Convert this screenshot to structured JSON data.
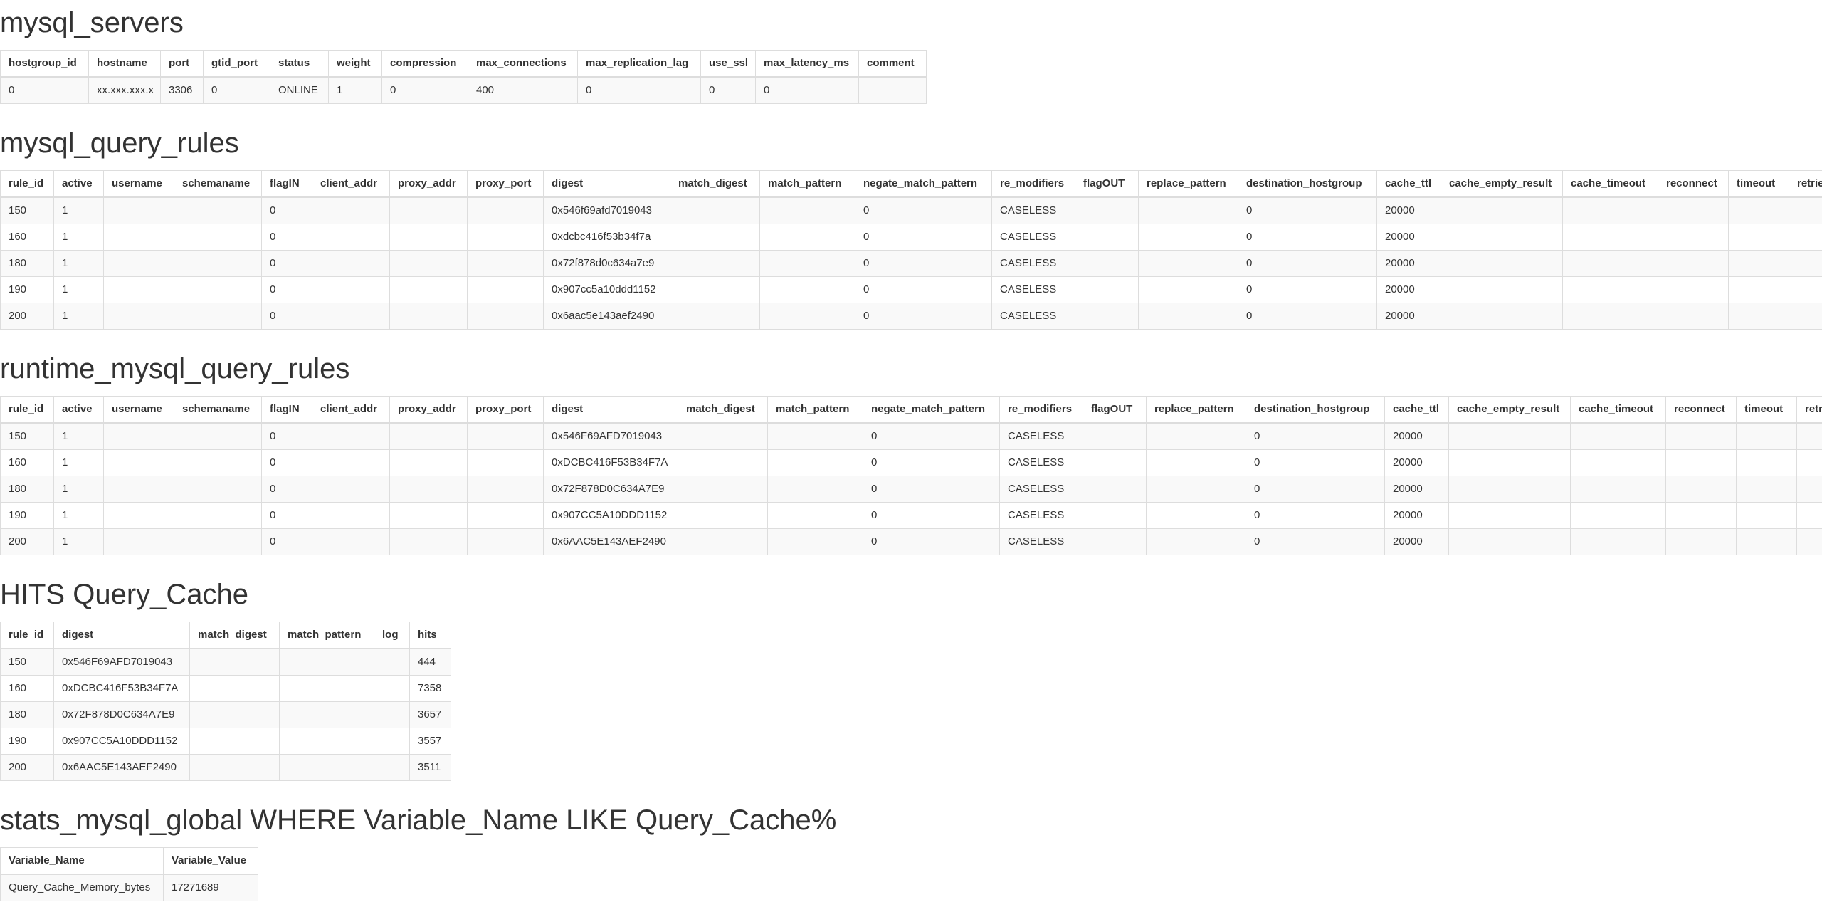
{
  "sections": [
    {
      "title": "mysql_servers",
      "headers": [
        "hostgroup_id",
        "hostname",
        "port",
        "gtid_port",
        "status",
        "weight",
        "compression",
        "max_connections",
        "max_replication_lag",
        "use_ssl",
        "max_latency_ms",
        "comment"
      ],
      "rows": [
        [
          "0",
          "xx.xxx.xxx.x",
          "3306",
          "0",
          "ONLINE",
          "1",
          "0",
          "400",
          "0",
          "0",
          "0",
          ""
        ]
      ]
    },
    {
      "title": "mysql_query_rules",
      "headers": [
        "rule_id",
        "active",
        "username",
        "schemaname",
        "flagIN",
        "client_addr",
        "proxy_addr",
        "proxy_port",
        "digest",
        "match_digest",
        "match_pattern",
        "negate_match_pattern",
        "re_modifiers",
        "flagOUT",
        "replace_pattern",
        "destination_hostgroup",
        "cache_ttl",
        "cache_empty_result",
        "cache_timeout",
        "reconnect",
        "timeout",
        "retries"
      ],
      "rows": [
        [
          "150",
          "1",
          "",
          "",
          "0",
          "",
          "",
          "",
          "0x546f69afd7019043",
          "",
          "",
          "0",
          "CASELESS",
          "",
          "",
          "0",
          "20000",
          "",
          "",
          "",
          "",
          ""
        ],
        [
          "160",
          "1",
          "",
          "",
          "0",
          "",
          "",
          "",
          "0xdcbc416f53b34f7a",
          "",
          "",
          "0",
          "CASELESS",
          "",
          "",
          "0",
          "20000",
          "",
          "",
          "",
          "",
          ""
        ],
        [
          "180",
          "1",
          "",
          "",
          "0",
          "",
          "",
          "",
          "0x72f878d0c634a7e9",
          "",
          "",
          "0",
          "CASELESS",
          "",
          "",
          "0",
          "20000",
          "",
          "",
          "",
          "",
          ""
        ],
        [
          "190",
          "1",
          "",
          "",
          "0",
          "",
          "",
          "",
          "0x907cc5a10ddd1152",
          "",
          "",
          "0",
          "CASELESS",
          "",
          "",
          "0",
          "20000",
          "",
          "",
          "",
          "",
          ""
        ],
        [
          "200",
          "1",
          "",
          "",
          "0",
          "",
          "",
          "",
          "0x6aac5e143aef2490",
          "",
          "",
          "0",
          "CASELESS",
          "",
          "",
          "0",
          "20000",
          "",
          "",
          "",
          "",
          ""
        ]
      ]
    },
    {
      "title": "runtime_mysql_query_rules",
      "headers": [
        "rule_id",
        "active",
        "username",
        "schemaname",
        "flagIN",
        "client_addr",
        "proxy_addr",
        "proxy_port",
        "digest",
        "match_digest",
        "match_pattern",
        "negate_match_pattern",
        "re_modifiers",
        "flagOUT",
        "replace_pattern",
        "destination_hostgroup",
        "cache_ttl",
        "cache_empty_result",
        "cache_timeout",
        "reconnect",
        "timeout",
        "retries"
      ],
      "rows": [
        [
          "150",
          "1",
          "",
          "",
          "0",
          "",
          "",
          "",
          "0x546F69AFD7019043",
          "",
          "",
          "0",
          "CASELESS",
          "",
          "",
          "0",
          "20000",
          "",
          "",
          "",
          "",
          ""
        ],
        [
          "160",
          "1",
          "",
          "",
          "0",
          "",
          "",
          "",
          "0xDCBC416F53B34F7A",
          "",
          "",
          "0",
          "CASELESS",
          "",
          "",
          "0",
          "20000",
          "",
          "",
          "",
          "",
          ""
        ],
        [
          "180",
          "1",
          "",
          "",
          "0",
          "",
          "",
          "",
          "0x72F878D0C634A7E9",
          "",
          "",
          "0",
          "CASELESS",
          "",
          "",
          "0",
          "20000",
          "",
          "",
          "",
          "",
          ""
        ],
        [
          "190",
          "1",
          "",
          "",
          "0",
          "",
          "",
          "",
          "0x907CC5A10DDD1152",
          "",
          "",
          "0",
          "CASELESS",
          "",
          "",
          "0",
          "20000",
          "",
          "",
          "",
          "",
          ""
        ],
        [
          "200",
          "1",
          "",
          "",
          "0",
          "",
          "",
          "",
          "0x6AAC5E143AEF2490",
          "",
          "",
          "0",
          "CASELESS",
          "",
          "",
          "0",
          "20000",
          "",
          "",
          "",
          "",
          ""
        ]
      ]
    },
    {
      "title": "HITS Query_Cache",
      "headers": [
        "rule_id",
        "digest",
        "match_digest",
        "match_pattern",
        "log",
        "hits"
      ],
      "rows": [
        [
          "150",
          "0x546F69AFD7019043",
          "",
          "",
          "",
          "444"
        ],
        [
          "160",
          "0xDCBC416F53B34F7A",
          "",
          "",
          "",
          "7358"
        ],
        [
          "180",
          "0x72F878D0C634A7E9",
          "",
          "",
          "",
          "3657"
        ],
        [
          "190",
          "0x907CC5A10DDD1152",
          "",
          "",
          "",
          "3557"
        ],
        [
          "200",
          "0x6AAC5E143AEF2490",
          "",
          "",
          "",
          "3511"
        ]
      ]
    },
    {
      "title": "stats_mysql_global WHERE Variable_Name LIKE Query_Cache%",
      "headers": [
        "Variable_Name",
        "Variable_Value"
      ],
      "rows": [
        [
          "Query_Cache_Memory_bytes",
          "17271689"
        ]
      ]
    }
  ]
}
